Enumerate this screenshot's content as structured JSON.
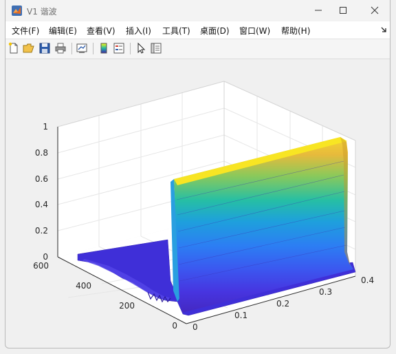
{
  "window": {
    "title": "V1 谐波"
  },
  "menu": [
    "文件(F)",
    "编辑(E)",
    "查看(V)",
    "插入(I)",
    "工具(T)",
    "桌面(D)",
    "窗口(W)",
    "帮助(H)"
  ],
  "toolbar": [
    {
      "icon": "new-figure-icon"
    },
    {
      "icon": "open-file-icon"
    },
    {
      "icon": "save-icon"
    },
    {
      "icon": "print-icon"
    },
    {
      "icon": "link-plot-icon"
    },
    {
      "icon": "colorbar-icon"
    },
    {
      "icon": "legend-icon"
    },
    {
      "icon": "edit-plot-icon"
    },
    {
      "icon": "property-inspector-icon"
    }
  ],
  "chart_data": {
    "type": "surface",
    "title": "",
    "xlabel": "",
    "ylabel": "",
    "zlabel": "",
    "xlim": [
      0,
      0.4
    ],
    "ylim": [
      0,
      600
    ],
    "zlim": [
      0,
      1
    ],
    "x_ticks": [
      0,
      0.1,
      0.2,
      0.3,
      0.4
    ],
    "y_ticks": [
      0,
      200,
      400,
      600
    ],
    "z_ticks": [
      0,
      0.2,
      0.4,
      0.6,
      0.8,
      1
    ],
    "x_tick_labels": [
      "0",
      "0.1",
      "0.2",
      "0.3",
      "0.4"
    ],
    "y_tick_labels": [
      "0",
      "200",
      "400",
      "600"
    ],
    "z_tick_labels": [
      "0",
      "0.2",
      "0.4",
      "0.6",
      "0.8",
      "1"
    ],
    "colormap": "parula",
    "grid": true,
    "description_of_shape": {
      "x": [
        0,
        0.02,
        0.05,
        0.1,
        0.15,
        0.2,
        0.25,
        0.3,
        0.35,
        0.4
      ],
      "z_at_low_y": [
        0.92,
        0.92,
        0.93,
        0.94,
        0.95,
        0.96,
        0.97,
        0.98,
        0.99,
        1.0
      ],
      "z_at_high_y": [
        0.05,
        0.04,
        0.03,
        0.03,
        0.02,
        0.02,
        0.02,
        0.02,
        0.02,
        0.01
      ],
      "step_at_y": 50
    }
  }
}
